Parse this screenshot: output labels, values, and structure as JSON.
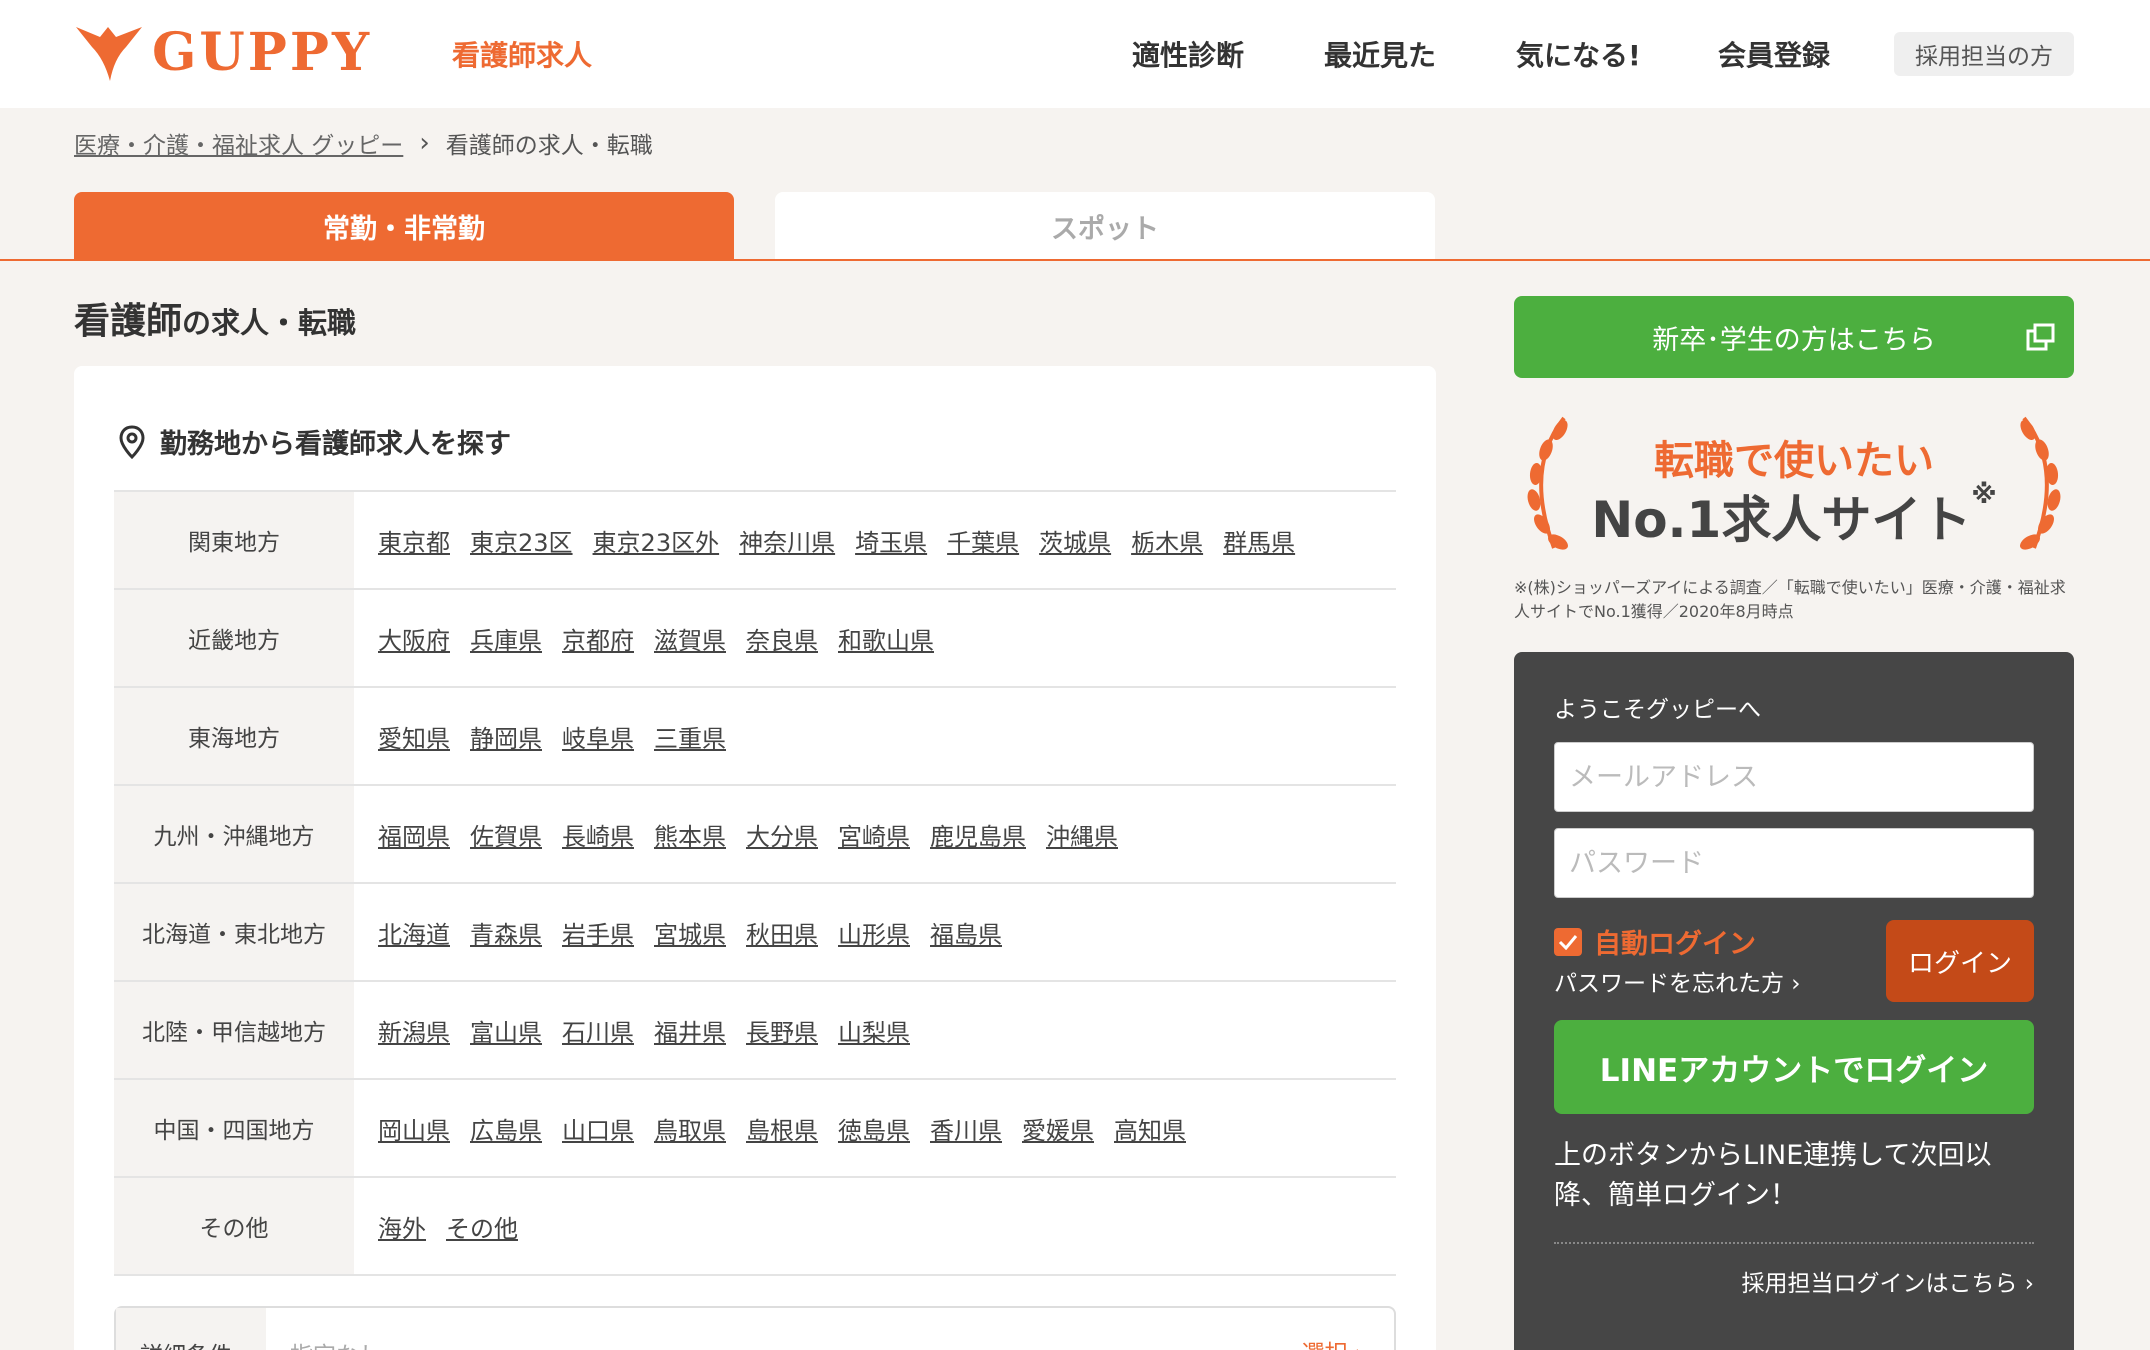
{
  "header": {
    "logo_text": "GUPPY",
    "category": "看護師求人",
    "nav": [
      "適性診断",
      "最近見た",
      "気になる!",
      "会員登録"
    ],
    "recruiter": "採用担当の方"
  },
  "breadcrumb": {
    "home": "医療・介護・福祉求人 グッピー",
    "sep": "›",
    "current": "看護師の求人・転職"
  },
  "tabs": {
    "active": "常勤・非常勤",
    "inactive": "スポット"
  },
  "title": {
    "big": "看護師",
    "small": "の求人・転職"
  },
  "search": {
    "heading": "勤務地から看護師求人を探す",
    "regions": [
      {
        "name": "関東地方",
        "prefs": [
          "東京都",
          "東京23区",
          "東京23区外",
          "神奈川県",
          "埼玉県",
          "千葉県",
          "茨城県",
          "栃木県",
          "群馬県"
        ]
      },
      {
        "name": "近畿地方",
        "prefs": [
          "大阪府",
          "兵庫県",
          "京都府",
          "滋賀県",
          "奈良県",
          "和歌山県"
        ]
      },
      {
        "name": "東海地方",
        "prefs": [
          "愛知県",
          "静岡県",
          "岐阜県",
          "三重県"
        ]
      },
      {
        "name": "九州・沖縄地方",
        "prefs": [
          "福岡県",
          "佐賀県",
          "長崎県",
          "熊本県",
          "大分県",
          "宮崎県",
          "鹿児島県",
          "沖縄県"
        ]
      },
      {
        "name": "北海道・東北地方",
        "prefs": [
          "北海道",
          "青森県",
          "岩手県",
          "宮城県",
          "秋田県",
          "山形県",
          "福島県"
        ]
      },
      {
        "name": "北陸・甲信越地方",
        "prefs": [
          "新潟県",
          "富山県",
          "石川県",
          "福井県",
          "長野県",
          "山梨県"
        ]
      },
      {
        "name": "中国・四国地方",
        "prefs": [
          "岡山県",
          "広島県",
          "山口県",
          "鳥取県",
          "島根県",
          "徳島県",
          "香川県",
          "愛媛県",
          "高知県"
        ]
      },
      {
        "name": "その他",
        "prefs": [
          "海外",
          "その他"
        ]
      }
    ],
    "detail_label": "詳細条件",
    "detail_value": "指定なし",
    "detail_select": "選択 ›"
  },
  "sidebar": {
    "new_grad": "新卒･学生の方はこちら",
    "award_line1": "転職で使いたい",
    "award_line2": "No.1求人サイト",
    "award_mark": "※",
    "award_note": "※(株)ショッパーズアイによる調査／「転職で使いたい」医療・介護・福祉求人サイトでNo.1獲得／2020年8月時点",
    "login": {
      "welcome": "ようこそグッピーへ",
      "email_placeholder": "メールアドレス",
      "password_placeholder": "パスワード",
      "auto_login": "自動ログイン",
      "forgot": "パスワードを忘れた方 ›",
      "login_button": "ログイン",
      "line_button": "LINEアカウントでログイン",
      "line_note": "上のボタンからLINE連携して次回以降、簡単ログイン！",
      "recruiter_login": "採用担当ログインはこちら ›"
    }
  },
  "colors": {
    "brand": "#ee6a32",
    "green": "#4caf3f",
    "dark": "#464646",
    "login_btn": "#c44a18"
  }
}
